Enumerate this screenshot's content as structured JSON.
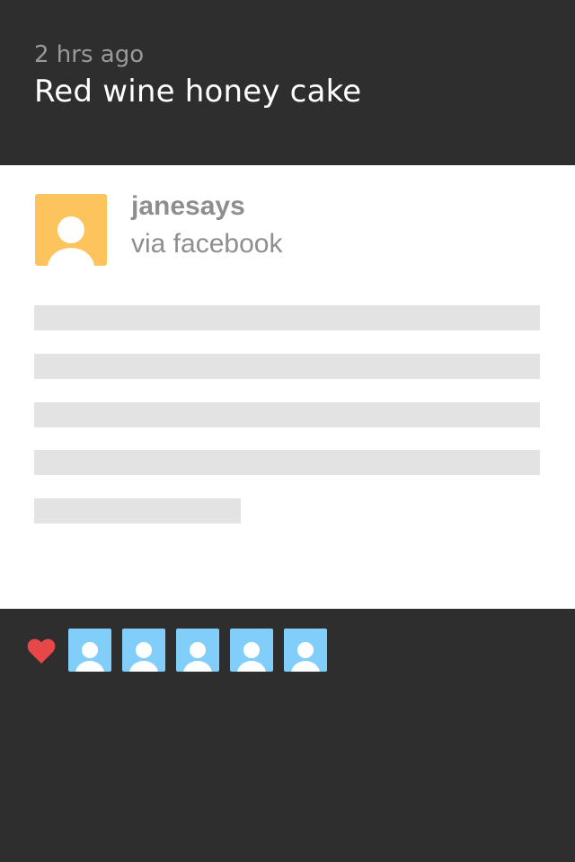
{
  "post": {
    "timestamp": "2 hrs ago",
    "title": "Red wine honey cake"
  },
  "author": {
    "name": "janesays",
    "via": "via facebook",
    "avatar_icon": "user-placeholder-icon",
    "avatar_color": "#fdc35c"
  },
  "body": {
    "placeholder_lines": 5
  },
  "likes": {
    "icon": "heart-icon",
    "heart_color": "#e8474a",
    "liker_color": "#80cef9",
    "likers": [
      "user",
      "user",
      "user",
      "user",
      "user"
    ]
  },
  "colors": {
    "background": "#2e2e2e",
    "card": "#ffffff",
    "skeleton": "#e3e3e3",
    "muted_text": "#8e8e8e"
  }
}
